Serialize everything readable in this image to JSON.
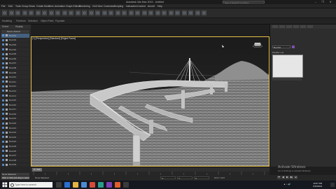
{
  "window": {
    "title": "Autodesk 3ds Max 2019 - Untitled",
    "search_placeholder": "Type a keyword or phrase",
    "controls": [
      "–",
      "❐",
      "✕"
    ]
  },
  "menu": [
    "File",
    "Edit",
    "Tools",
    "Group",
    "Views",
    "Create",
    "Modifiers",
    "Animation",
    "Graph Editors",
    "Rendering",
    "Civil View",
    "Customize",
    "Scripting",
    "Interactive",
    "Content",
    "Arnold",
    "Help"
  ],
  "ribbon_tabs": [
    "Modeling",
    "Freeform",
    "Selection",
    "Object Paint",
    "Populate"
  ],
  "explorer": {
    "tabs": [
      "Select",
      "Display"
    ],
    "header": "Name (Sorted Ascending)",
    "rows": [
      "Box001",
      "Box002",
      "Box003",
      "Box004",
      "Box005",
      "Box006",
      "Box007",
      "Box008",
      "Box009",
      "Box010",
      "Box011",
      "Box012",
      "Box013",
      "Box014",
      "Box015",
      "Box016",
      "Box017",
      "Box018",
      "Box019",
      "Box020",
      "Box021",
      "Box022",
      "Box023",
      "Box024",
      "Box025",
      "Box026",
      "Box027",
      "Box028",
      "Box029",
      "Box030",
      "Box031",
      "Box032",
      "Box033"
    ],
    "selected_index": 0
  },
  "viewport": {
    "label": "[+] [Perspective] [Standard] [Edged Faces]"
  },
  "command_panel": {
    "object_name": "Box001",
    "modifier_list_label": "Modifier List",
    "accent": "#7c4fb0"
  },
  "timeline": {
    "slider": "0 / 100"
  },
  "status": {
    "selection": "None Selected",
    "prompt": "Click or click-and-drag to select objects",
    "x": "X:",
    "y": "Y:",
    "z": "Z:",
    "grid": "Grid = 10.0",
    "playback": [
      "⏮",
      "◀",
      "▶",
      "▶|",
      "⏭"
    ]
  },
  "activate": {
    "line1": "Activate Windows",
    "line2": "Go to Settings to activate Windows."
  },
  "taskbar": {
    "search": "Type here to search",
    "clock_time": "10:57 PM",
    "clock_date": "3/10/2021"
  },
  "colors": {
    "viewport_border": "#e8c04a",
    "selection": "#45607e"
  }
}
